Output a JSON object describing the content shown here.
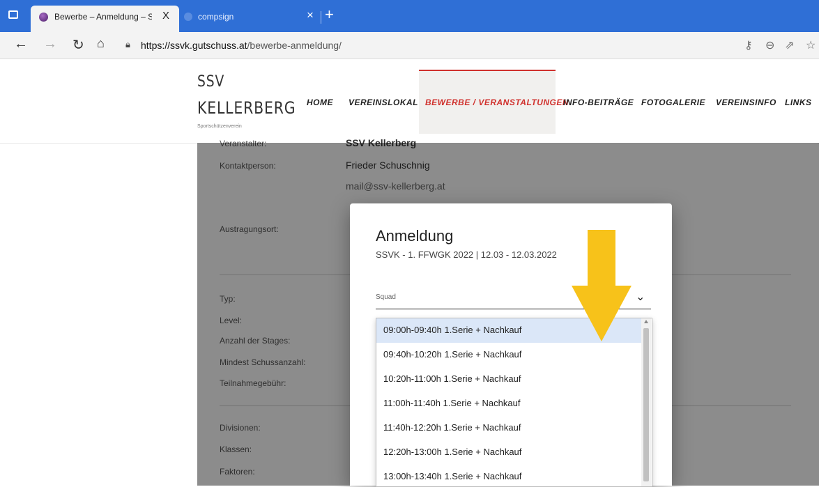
{
  "browser": {
    "tabs": [
      {
        "title": "Bewerbe – Anmeldung – SSV Kel",
        "close": "X"
      },
      {
        "title": "compsign",
        "close": "×"
      }
    ],
    "new_tab": "+",
    "url_host": "https://ssvk.gutschuss.at",
    "url_path": "/bewerbe-anmeldung/",
    "icons": [
      "back-icon",
      "forward-icon",
      "reload-icon",
      "home-icon",
      "lock-icon",
      "key-icon",
      "zoom-icon",
      "share-icon",
      "favorite-icon"
    ]
  },
  "site": {
    "logo_line1": "SSV",
    "logo_line2": "KELLERBERG",
    "logo_sub": "Sportschützenverein",
    "nav": [
      "HOME",
      "VEREINSLOKAL",
      "BEWERBE / VERANSTALTUNGEN",
      "INFO-BEITRÄGE",
      "FOTOGALERIE",
      "VEREINSINFO",
      "LINKS"
    ],
    "accent": "#d0312d"
  },
  "details": {
    "veranstalter_label": "Veranstalter:",
    "veranstalter_value": "SSV Kellerberg",
    "kontakt_label": "Kontaktperson:",
    "kontakt_value": "Frieder Schuschnig",
    "email": "mail@ssv-kellerberg.at",
    "ort_label": "Austragungsort:",
    "typ_label": "Typ:",
    "level_label": "Level:",
    "stages_label": "Anzahl der Stages:",
    "schuss_label": "Mindest Schussanzahl:",
    "gebuehr_label": "Teilnahmegebühr:",
    "divisionen_label": "Divisionen:",
    "klassen_label": "Klassen:",
    "faktoren_label": "Faktoren:"
  },
  "modal": {
    "title": "Anmeldung",
    "subtitle": "SSVK - 1. FFWGK 2022 | 12.03 - 12.03.2022",
    "select_label": "Squad",
    "options": [
      "09:00h-09:40h 1.Serie + Nachkauf",
      "09:40h-10:20h 1.Serie + Nachkauf",
      "10:20h-11:00h 1.Serie + Nachkauf",
      "11:00h-11:40h 1.Serie + Nachkauf",
      "11:40h-12:20h 1.Serie + Nachkauf",
      "12:20h-13:00h 1.Serie + Nachkauf",
      "13:00h-13:40h 1.Serie + Nachkauf"
    ]
  }
}
